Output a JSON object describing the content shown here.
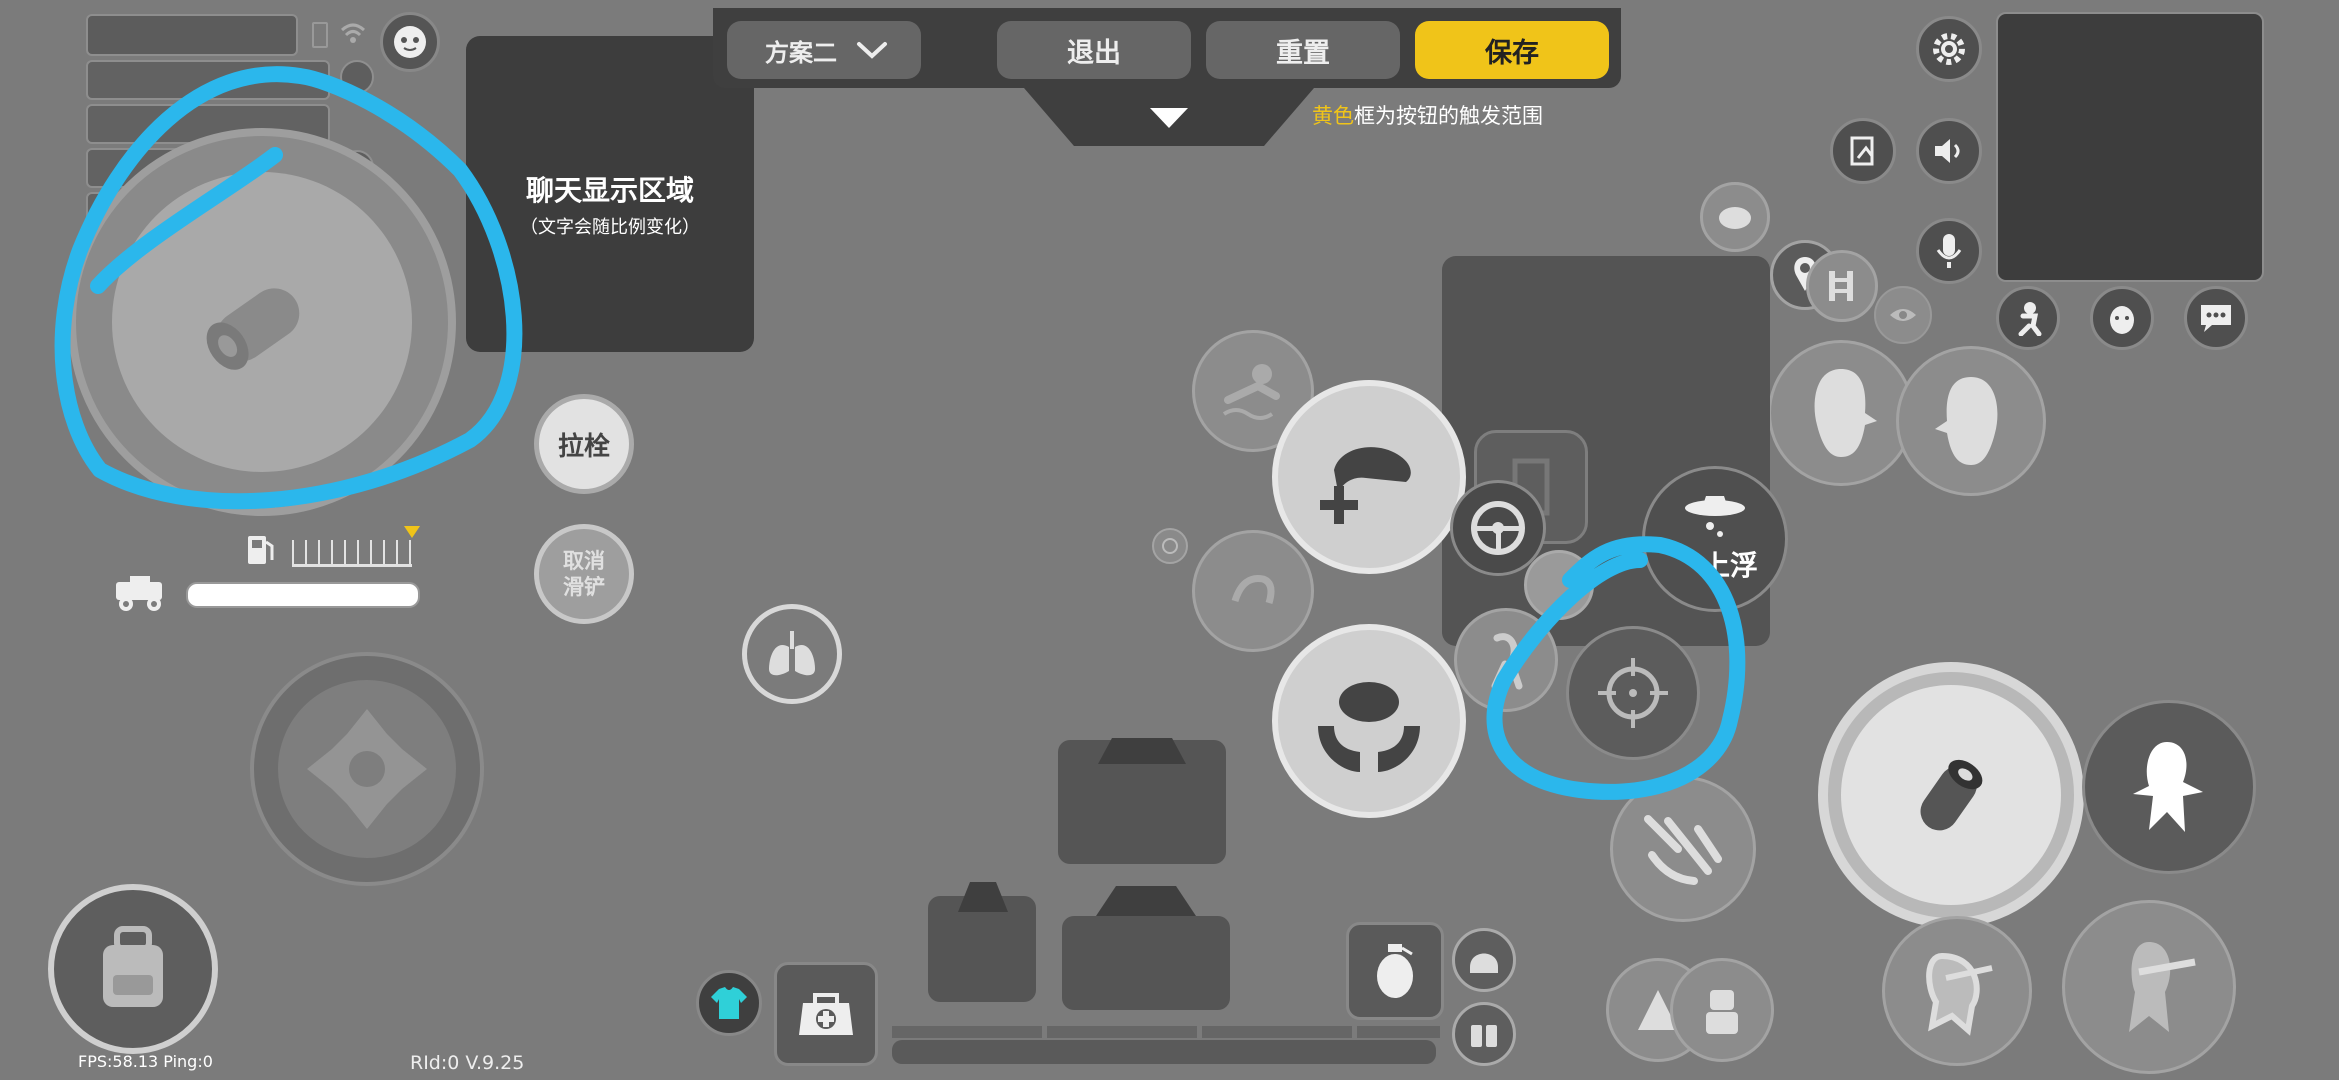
{
  "top_bar": {
    "scheme": "方案二",
    "exit": "退出",
    "reset": "重置",
    "save": "保存"
  },
  "hint": {
    "highlight": "黄色",
    "rest": "框为按钮的触发范围"
  },
  "chat_area": {
    "title": "聊天显示区域",
    "subtitle": "（文字会随比例变化）"
  },
  "buttons": {
    "bolt": "拉栓",
    "cancel_slide": "取消滑铲",
    "float": "上浮"
  },
  "status": {
    "fps": "FPS:58.13 Ping:0",
    "version": "RId:0 V.9.25"
  },
  "colors": {
    "accent": "#f0c419",
    "annotation": "#2bb7ec",
    "teal": "#2fd0d8"
  },
  "icons": [
    "gear-icon",
    "map-pin-icon",
    "exit-icon",
    "speaker-icon",
    "mic-icon",
    "eye-icon",
    "chat-icon",
    "bullet-icon",
    "swim-icon",
    "lungs-icon",
    "backpack-icon",
    "grenade-icon",
    "medkit-icon",
    "crosshair-icon",
    "steering-wheel-icon",
    "helmet-icon",
    "bottle-icon"
  ]
}
